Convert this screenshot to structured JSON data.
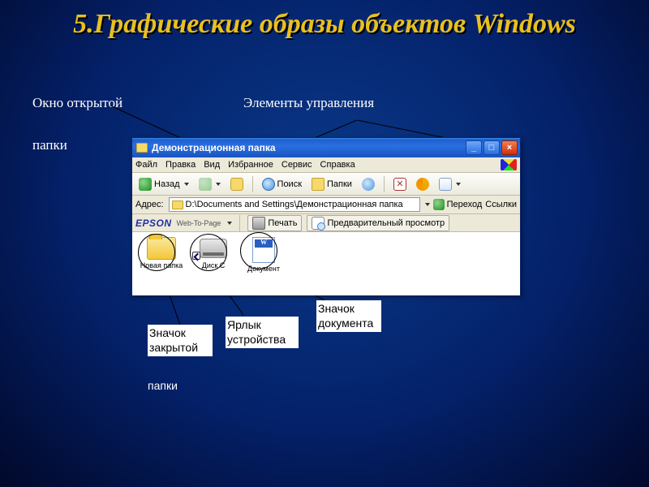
{
  "slide": {
    "title": "5.Графические образы объектов Windows"
  },
  "labels": {
    "open_folder_window": "Окно открытой",
    "open_folder_window2": "папки",
    "controls": "Элементы управления"
  },
  "captions": {
    "closed_folder_icon": "Значок закрытой",
    "closed_folder_icon2": "папки",
    "device_shortcut": "Ярлык устройства",
    "document_icon": "Значок документа"
  },
  "window": {
    "title": "Демонстрационная папка",
    "menu": {
      "file": "Файл",
      "edit": "Правка",
      "view": "Вид",
      "favorites": "Избранное",
      "service": "Сервис",
      "help": "Справка"
    },
    "toolbar": {
      "back": "Назад",
      "search": "Поиск",
      "folders": "Папки"
    },
    "address_label": "Адрес:",
    "address_path": "D:\\Documents and Settings\\Демонстрационная папка",
    "go": "Переход",
    "links": "Ссылки",
    "epson": {
      "brand": "EPSON",
      "sub": "Web-To-Page",
      "print": "Печать",
      "preview": "Предварительный просмотр"
    },
    "items": {
      "folder": "Новая папка",
      "disk": "Диск С",
      "doc": "Документ"
    }
  }
}
